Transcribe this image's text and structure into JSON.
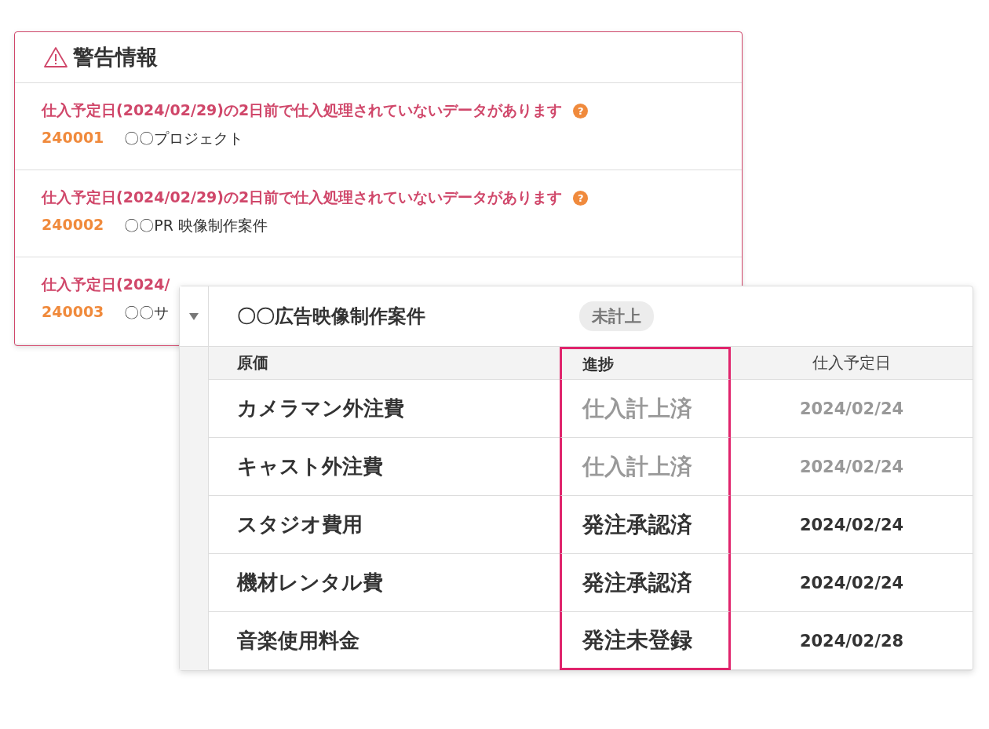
{
  "warning_panel": {
    "title": "警告情報",
    "warnings": [
      {
        "message": "仕入予定日(2024/02/29)の2日前で仕入処理されていないデータがあります",
        "help_icon": "?",
        "code": "240001",
        "project": "〇〇プロジェクト"
      },
      {
        "message": "仕入予定日(2024/02/29)の2日前で仕入処理されていないデータがあります",
        "help_icon": "?",
        "code": "240002",
        "project": "〇〇PR 映像制作案件"
      },
      {
        "message": "仕入予定日(2024/",
        "code": "240003",
        "project": "〇〇サ"
      }
    ]
  },
  "cost_table": {
    "project": "〇〇広告映像制作案件",
    "expanded": true,
    "status_badge": "未計上",
    "columns": [
      {
        "label": "原価",
        "highlighted": false
      },
      {
        "label": "進捗",
        "highlighted": true
      },
      {
        "label": "仕入予定日",
        "highlighted": false
      }
    ],
    "rows": [
      {
        "item": "カメラマン外注費",
        "progress": "仕入計上済",
        "date": "2024/02/24",
        "completed": true
      },
      {
        "item": "キャスト外注費",
        "progress": "仕入計上済",
        "date": "2024/02/24",
        "completed": true
      },
      {
        "item": "スタジオ費用",
        "progress": "発注承認済",
        "date": "2024/02/24",
        "completed": false
      },
      {
        "item": "機材レンタル費",
        "progress": "発注承認済",
        "date": "2024/02/24",
        "completed": false
      },
      {
        "item": "音楽使用料金",
        "progress": "発注未登録",
        "date": "2024/02/28",
        "completed": false
      }
    ]
  }
}
